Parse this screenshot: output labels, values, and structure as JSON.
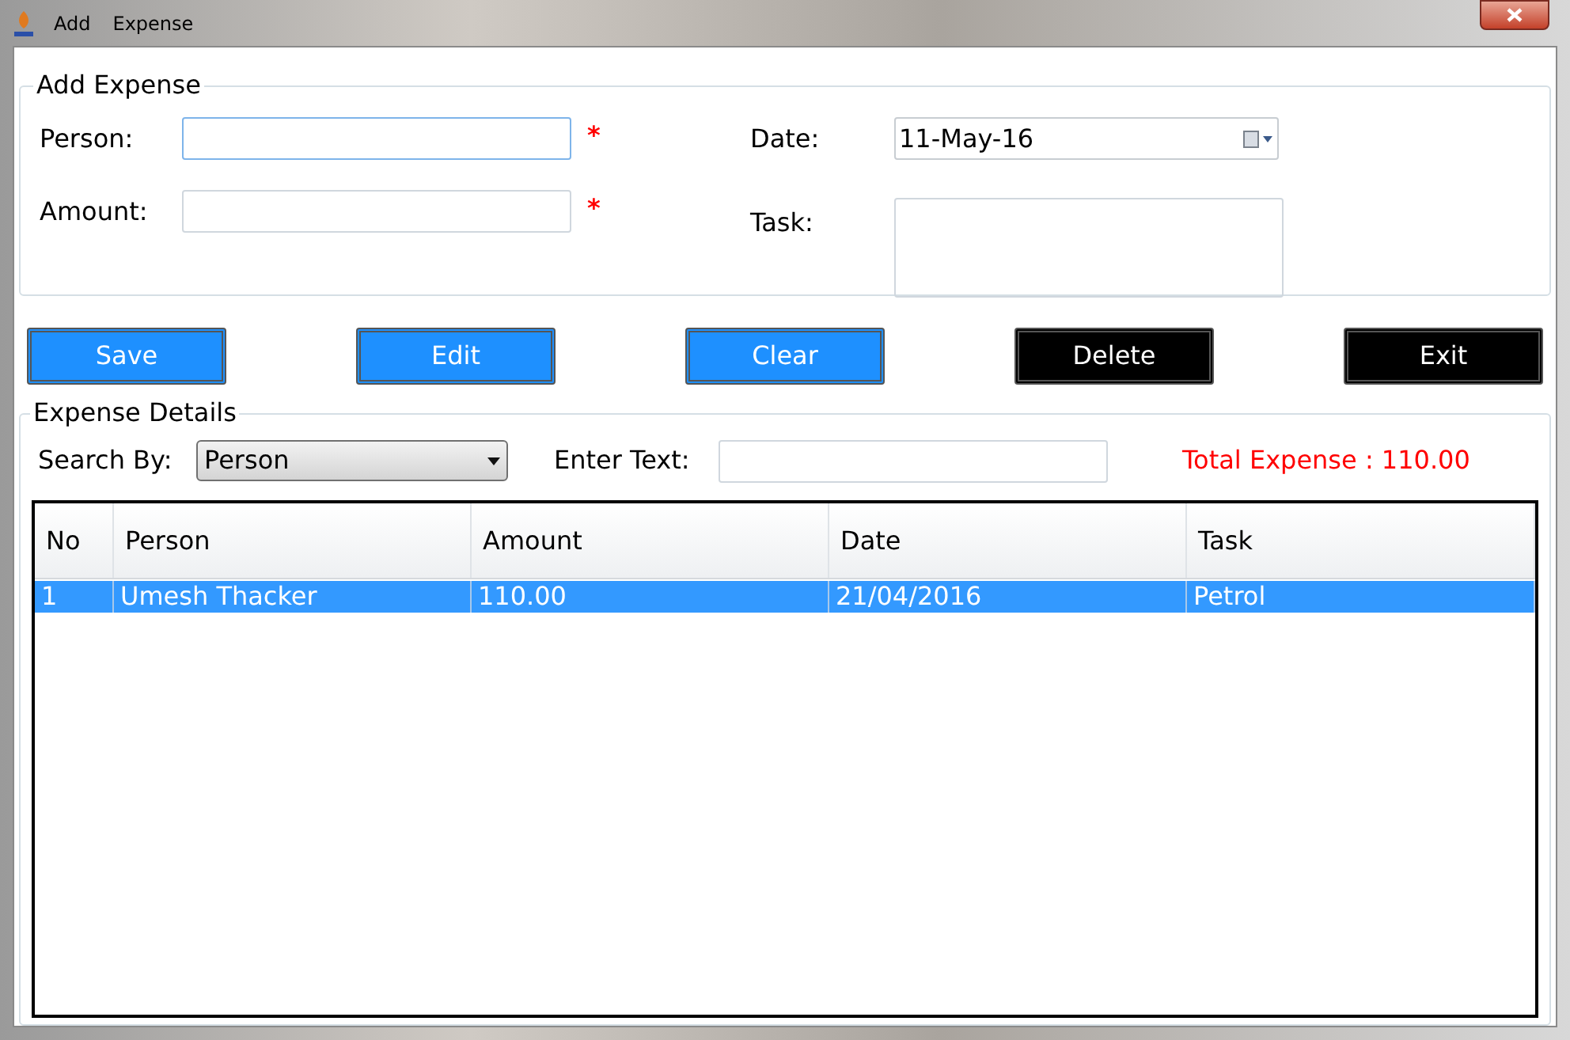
{
  "window": {
    "title_words": [
      "Add",
      "Expense"
    ]
  },
  "add_expense": {
    "legend": "Add Expense",
    "person": {
      "label": "Person:",
      "required_mark": "*"
    },
    "amount": {
      "label": "Amount:",
      "required_mark": "*"
    },
    "date": {
      "label": "Date:",
      "value": "11-May-16"
    },
    "task": {
      "label": "Task:"
    }
  },
  "buttons": [
    {
      "label": "Save",
      "kind": "primary"
    },
    {
      "label": "Edit",
      "kind": "primary"
    },
    {
      "label": "Clear",
      "kind": "primary"
    },
    {
      "label": "Delete",
      "kind": "dark"
    },
    {
      "label": "Exit",
      "kind": "dark"
    }
  ],
  "expense_details": {
    "legend": "Expense Details",
    "search_by_label": "Search By:",
    "search_by_value": "Person",
    "enter_text_label": "Enter Text:",
    "total": "Total Expense : 110.00"
  },
  "table": {
    "columns": [
      "No",
      "Person",
      "Amount",
      "Date",
      "Task"
    ],
    "rows": [
      {
        "cells": [
          "1",
          "Umesh Thacker",
          "110.00",
          "21/04/2016",
          "Petrol"
        ],
        "selected": true
      }
    ]
  }
}
